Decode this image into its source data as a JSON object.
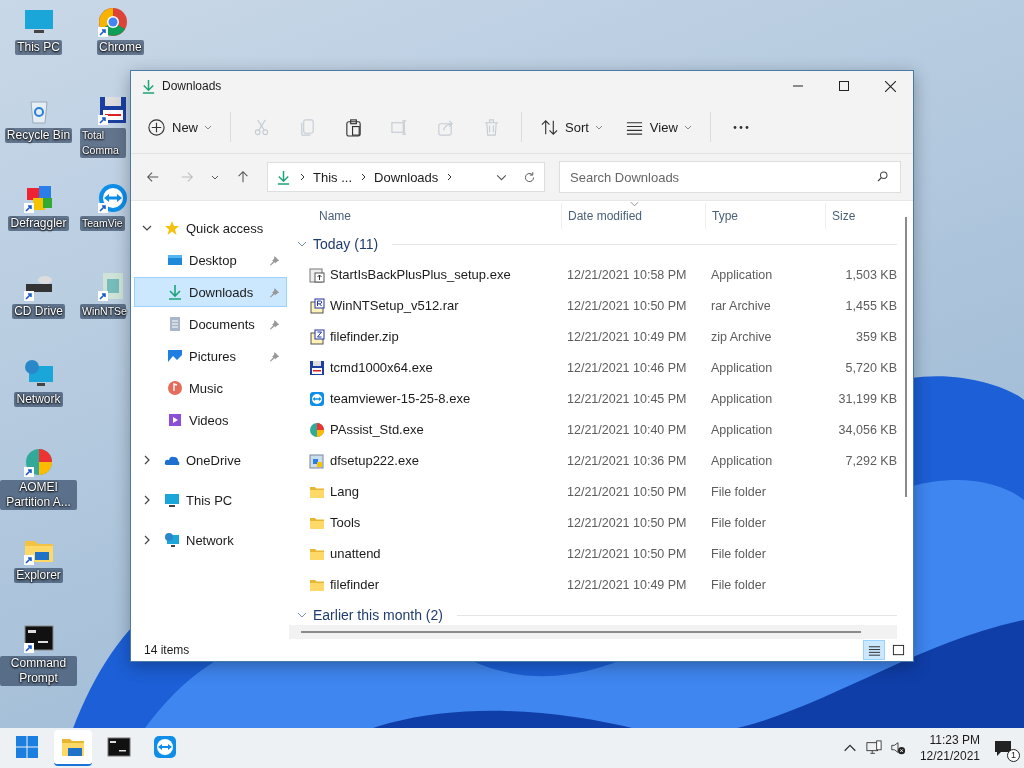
{
  "desktop_icons": [
    {
      "label": "This PC",
      "kind": "pc",
      "shortcut": false
    },
    {
      "label": "Recycle Bin",
      "kind": "recycle",
      "shortcut": false
    },
    {
      "label": "Defraggler",
      "kind": "defrag",
      "shortcut": true
    },
    {
      "label": "CD Drive",
      "kind": "drive",
      "shortcut": true
    },
    {
      "label": "Network",
      "kind": "network",
      "shortcut": false
    },
    {
      "label": "AOMEI Partition A...",
      "kind": "aomei",
      "shortcut": true
    },
    {
      "label": "Explorer",
      "kind": "folder",
      "shortcut": true
    },
    {
      "label": "Command Prompt",
      "kind": "cmd",
      "shortcut": true
    },
    {
      "label": "Chrome",
      "kind": "chrome",
      "shortcut": true
    },
    {
      "label": "Total Comma",
      "kind": "tcmd",
      "shortcut": true
    },
    {
      "label": "TeamVie",
      "kind": "teamviewer",
      "shortcut": true
    },
    {
      "label": "WinNTSe",
      "kind": "setup",
      "shortcut": true
    }
  ],
  "window": {
    "title": "Downloads",
    "toolbar": [
      {
        "kind": "new",
        "label": "New",
        "disabled": false
      },
      {
        "kind": "cut",
        "disabled": true
      },
      {
        "kind": "copy",
        "disabled": true
      },
      {
        "kind": "paste",
        "disabled": false
      },
      {
        "kind": "rename",
        "disabled": true
      },
      {
        "kind": "share",
        "disabled": true
      },
      {
        "kind": "delete",
        "disabled": true
      },
      {
        "kind": "sort",
        "label": "Sort",
        "disabled": false
      },
      {
        "kind": "view",
        "label": "View",
        "disabled": false
      },
      {
        "kind": "more",
        "disabled": false
      }
    ],
    "nav": {
      "back_disabled": false,
      "forward_disabled": true
    },
    "breadcrumbs": [
      "This ...",
      "Downloads"
    ],
    "search": {
      "placeholder": "Search Downloads"
    },
    "sidebar": [
      {
        "label": "Quick access",
        "kind": "star",
        "expanded": true,
        "children": [
          {
            "label": "Desktop",
            "kind": "desktop",
            "pinned": true,
            "selected": false
          },
          {
            "label": "Downloads",
            "kind": "download",
            "pinned": true,
            "selected": true
          },
          {
            "label": "Documents",
            "kind": "documents",
            "pinned": true,
            "selected": false
          },
          {
            "label": "Pictures",
            "kind": "pictures",
            "pinned": true,
            "selected": false
          },
          {
            "label": "Music",
            "kind": "music",
            "pinned": false,
            "selected": false
          },
          {
            "label": "Videos",
            "kind": "videos",
            "pinned": false,
            "selected": false
          }
        ]
      },
      {
        "label": "OneDrive",
        "kind": "cloud",
        "expanded": false
      },
      {
        "label": "This PC",
        "kind": "pc",
        "expanded": false
      },
      {
        "label": "Network",
        "kind": "network",
        "expanded": false
      }
    ],
    "columns": [
      {
        "label": "Name",
        "sorted": false
      },
      {
        "label": "Date modified",
        "sorted": true
      },
      {
        "label": "Type",
        "sorted": false
      },
      {
        "label": "Size",
        "sorted": false
      }
    ],
    "groups": [
      {
        "label": "Today (11)",
        "expanded": true,
        "rows": [
          {
            "name": "StartIsBackPlusPlus_setup.exe",
            "kind": "setup",
            "date": "12/21/2021 10:58 PM",
            "type": "Application",
            "size": "1,503 KB"
          },
          {
            "name": "WinNTSetup_v512.rar",
            "kind": "rar",
            "date": "12/21/2021 10:50 PM",
            "type": "rar Archive",
            "size": "1,455 KB"
          },
          {
            "name": "filefinder.zip",
            "kind": "zip",
            "date": "12/21/2021 10:49 PM",
            "type": "zip Archive",
            "size": "359 KB"
          },
          {
            "name": "tcmd1000x64.exe",
            "kind": "tcmd",
            "date": "12/21/2021 10:46 PM",
            "type": "Application",
            "size": "5,720 KB"
          },
          {
            "name": "teamviewer-15-25-8.exe",
            "kind": "teamviewer",
            "date": "12/21/2021 10:45 PM",
            "type": "Application",
            "size": "31,199 KB"
          },
          {
            "name": "PAssist_Std.exe",
            "kind": "aomei",
            "date": "12/21/2021 10:40 PM",
            "type": "Application",
            "size": "34,056 KB"
          },
          {
            "name": "dfsetup222.exe",
            "kind": "defrag",
            "date": "12/21/2021 10:36 PM",
            "type": "Application",
            "size": "7,292 KB"
          },
          {
            "name": "Lang",
            "kind": "folder",
            "date": "12/21/2021 10:50 PM",
            "type": "File folder"
          },
          {
            "name": "Tools",
            "kind": "folder",
            "date": "12/21/2021 10:50 PM",
            "type": "File folder"
          },
          {
            "name": "unattend",
            "kind": "folder",
            "date": "12/21/2021 10:50 PM",
            "type": "File folder"
          },
          {
            "name": "filefinder",
            "kind": "folder",
            "date": "12/21/2021 10:49 PM",
            "type": "File folder"
          }
        ]
      },
      {
        "label": "Earlier this month (2)",
        "expanded": true
      }
    ],
    "status": "14 items",
    "view_modes": [
      {
        "kind": "details",
        "selected": true
      },
      {
        "kind": "tiles",
        "selected": false
      }
    ]
  },
  "taskbar": {
    "apps": [
      {
        "kind": "start",
        "active": false
      },
      {
        "kind": "folder",
        "active": true
      },
      {
        "kind": "cmd",
        "active": false
      },
      {
        "kind": "teamviewer",
        "active": false
      }
    ],
    "time": "11:23 PM",
    "date": "12/21/2021",
    "notifications": "1"
  }
}
